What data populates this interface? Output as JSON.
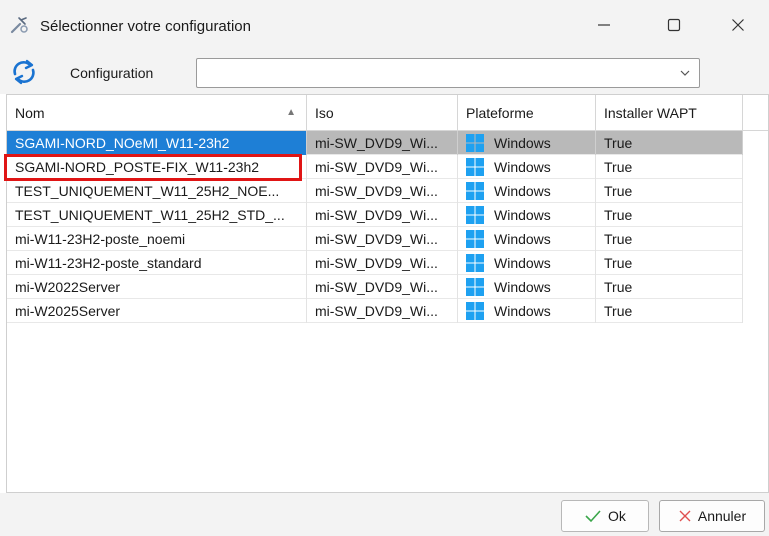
{
  "window": {
    "title": "Sélectionner votre configuration",
    "icon": "wrench-gear-icon"
  },
  "toolbar": {
    "refresh_icon": "refresh-icon",
    "config_label": "Configuration",
    "config_value": ""
  },
  "grid": {
    "columns": [
      "Nom",
      "Iso",
      "Plateforme",
      "Installer WAPT"
    ],
    "rows": [
      {
        "nom": "SGAMI-NORD_NOeMI_W11-23h2",
        "iso": "mi-SW_DVD9_Wi...",
        "plateforme": "Windows",
        "wapt": "True",
        "selected": true
      },
      {
        "nom": "SGAMI-NORD_POSTE-FIX_W11-23h2",
        "iso": "mi-SW_DVD9_Wi...",
        "plateforme": "Windows",
        "wapt": "True"
      },
      {
        "nom": "TEST_UNIQUEMENT_W11_25H2_NOE...",
        "iso": "mi-SW_DVD9_Wi...",
        "plateforme": "Windows",
        "wapt": "True"
      },
      {
        "nom": "TEST_UNIQUEMENT_W11_25H2_STD_...",
        "iso": "mi-SW_DVD9_Wi...",
        "plateforme": "Windows",
        "wapt": "True"
      },
      {
        "nom": "mi-W11-23H2-poste_noemi",
        "iso": "mi-SW_DVD9_Wi...",
        "plateforme": "Windows",
        "wapt": "True"
      },
      {
        "nom": "mi-W11-23H2-poste_standard",
        "iso": "mi-SW_DVD9_Wi...",
        "plateforme": "Windows",
        "wapt": "True"
      },
      {
        "nom": "mi-W2022Server",
        "iso": "mi-SW_DVD9_Wi...",
        "plateforme": "Windows",
        "wapt": "True"
      },
      {
        "nom": "mi-W2025Server",
        "iso": "mi-SW_DVD9_Wi...",
        "plateforme": "Windows",
        "wapt": "True"
      }
    ]
  },
  "buttons": {
    "ok_label": "Ok",
    "cancel_label": "Annuler"
  },
  "colors": {
    "selection": "#1e7fd6",
    "highlight": "#e01515",
    "windows_blue": "#1ea1f1"
  }
}
